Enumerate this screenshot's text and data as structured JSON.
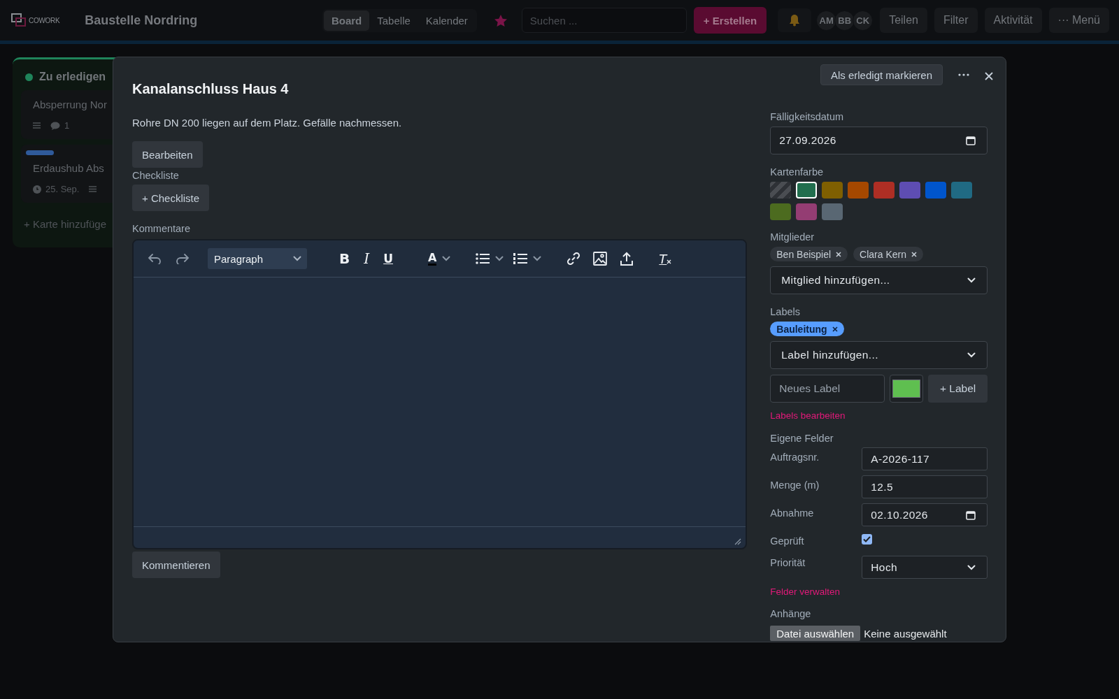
{
  "header": {
    "logo": "COWORK",
    "board_title": "Baustelle Nordring",
    "views": [
      {
        "label": "Board",
        "selected": true
      },
      {
        "label": "Tabelle",
        "selected": false
      },
      {
        "label": "Kalender",
        "selected": false
      }
    ],
    "search": {
      "placeholder": "Suchen ..."
    },
    "create_button": "+ Erstellen",
    "avatars": [
      "AM",
      "BB",
      "CK"
    ],
    "buttons": [
      "Teilen",
      "Filter",
      "Aktivität",
      "··· Menü"
    ]
  },
  "board": {
    "columns": [
      {
        "title": "Zu erledigen",
        "color": "#1f845a",
        "cards": [
          {
            "title": "Absperrung Nor",
            "description": true,
            "comments": "1"
          },
          {
            "labels": [
              {
                "color": "#2f5a9a"
              }
            ],
            "title": "Erdaushub Abs",
            "due": "25. Sep.",
            "description": true
          }
        ],
        "add_card": "+ Karte hinzufüge"
      }
    ]
  },
  "modal": {
    "title": "Kanalanschluss Haus 4",
    "mark_done_button": "Als erledigt markieren",
    "description": "Rohre DN 200 liegen auf dem Platz. Gefälle nachmessen.",
    "edit_button": "Bearbeiten",
    "checklist": {
      "heading": "Checkliste",
      "add_button": "+ Checkliste"
    },
    "comments": {
      "heading": "Kommentare",
      "block_format": "Paragraph",
      "format_buttons": [
        {
          "kind": "bold",
          "glyph": "B"
        },
        {
          "kind": "italic",
          "glyph": "I"
        },
        {
          "kind": "underline",
          "glyph": "U"
        }
      ],
      "text_color_glyph": "A",
      "clear_format_glyph": "T",
      "submit_button": "Kommentieren"
    },
    "sidebar": {
      "due_date": {
        "label": "Fälligkeitsdatum",
        "value": "27.09.2026"
      },
      "card_color": {
        "label": "Kartenfarbe",
        "swatches": [
          {
            "kind": "none",
            "selected": false
          },
          {
            "kind": "color",
            "color": "#216e4e",
            "selected": true
          },
          {
            "kind": "color",
            "color": "#7f5f01",
            "selected": false
          },
          {
            "kind": "color",
            "color": "#a54800",
            "selected": false
          },
          {
            "kind": "color",
            "color": "#ae2e24",
            "selected": false
          },
          {
            "kind": "color",
            "color": "#5e4db2",
            "selected": false
          },
          {
            "kind": "color",
            "color": "#0055cc",
            "selected": false
          },
          {
            "kind": "color",
            "color": "#206a83",
            "selected": false
          },
          {
            "kind": "color",
            "color": "#4c6b1f",
            "selected": false
          },
          {
            "kind": "color",
            "color": "#943d73",
            "selected": false
          },
          {
            "kind": "color",
            "color": "#596773",
            "selected": false
          }
        ]
      },
      "members": {
        "label": "Mitglieder",
        "chips": [
          "Ben Beispiel",
          "Clara Kern"
        ],
        "select": "Mitglied hinzufügen..."
      },
      "labels": {
        "label": "Labels",
        "chips": [
          {
            "text": "Bauleitung",
            "color": "#579dff"
          }
        ],
        "select": "Label hinzufügen...",
        "new_label": {
          "placeholder": "Neues Label",
          "color": "#5fbf50",
          "add_button": "+ Label"
        },
        "edit_link": "Labels bearbeiten"
      },
      "custom_fields": {
        "heading": "Eigene Felder",
        "fields": [
          {
            "label": "Auftragsnr.",
            "kind": "text",
            "value": "A-2026-117"
          },
          {
            "label": "Menge (m)",
            "kind": "text",
            "value": "12.5"
          },
          {
            "label": "Abnahme",
            "kind": "date",
            "value": "02.10.2026"
          },
          {
            "label": "Geprüft",
            "kind": "checkbox",
            "checked": true
          },
          {
            "label": "Priorität",
            "kind": "select",
            "value": "Hoch"
          }
        ],
        "manage_link": "Felder verwalten"
      },
      "attachments": {
        "label": "Anhänge",
        "button": "Datei auswählen",
        "status": "Keine ausgewählt"
      }
    }
  }
}
